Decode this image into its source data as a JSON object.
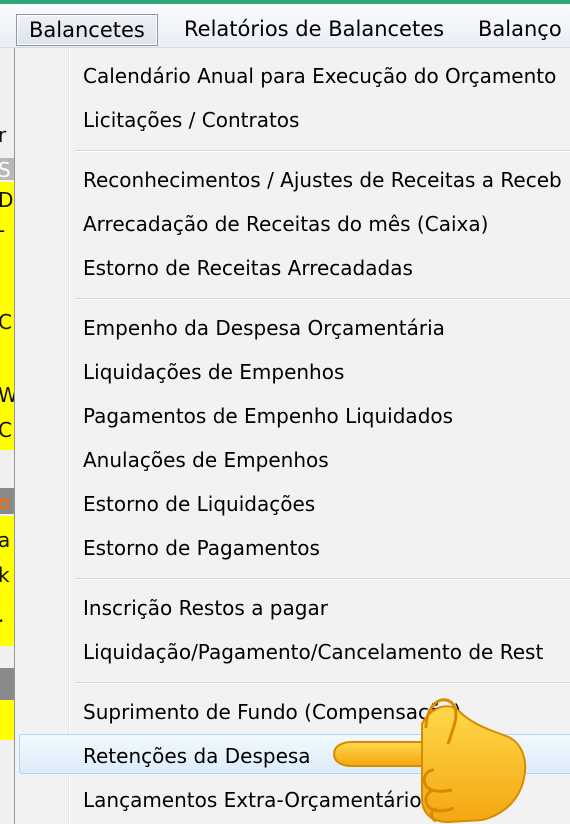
{
  "menubar": {
    "items": [
      {
        "label": "Balancetes"
      },
      {
        "label": "Relatórios de Balancetes"
      },
      {
        "label": "Balanço ."
      }
    ]
  },
  "background_window": {
    "glyphs": [
      "r",
      "S",
      "D",
      "-",
      "C",
      "W",
      "C",
      "o",
      "a",
      "k",
      "."
    ]
  },
  "dropdown": {
    "groups": [
      [
        "Calendário Anual para Execução do Orçamento",
        "Licitações / Contratos"
      ],
      [
        "Reconhecimentos / Ajustes de Receitas a Receb",
        "Arrecadação de Receitas do mês (Caixa)",
        "Estorno de Receitas Arrecadadas"
      ],
      [
        "Empenho da Despesa Orçamentária",
        "Liquidações de Empenhos",
        "Pagamentos de Empenho Liquidados",
        "Anulações de Empenhos",
        "Estorno de Liquidações",
        "Estorno de Pagamentos"
      ],
      [
        "Inscrição Restos a pagar",
        "Liquidação/Pagamento/Cancelamento de Rest"
      ],
      [
        "Suprimento de Fundo (Compensação)",
        "Retenções da Despesa",
        "Lançamentos Extra-Orçamentários"
      ]
    ],
    "highlighted_item": "Retenções da Despesa"
  },
  "colors": {
    "highlight_border": "#a8d8f5",
    "yellow_bg": "#ffff00",
    "menu_accent": "#2fa57a"
  },
  "icons": [
    "pointing-hand-icon"
  ]
}
